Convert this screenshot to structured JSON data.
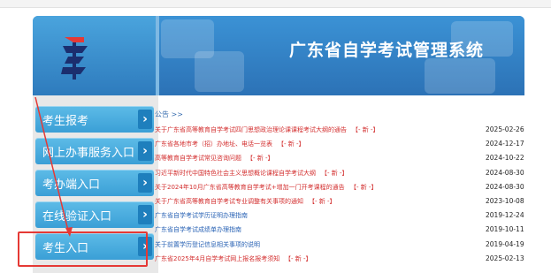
{
  "topbar": {
    "crumbs": ""
  },
  "header": {
    "title": "广东省自学考试管理系统"
  },
  "sidebar": {
    "items": [
      {
        "label": "考生报考"
      },
      {
        "label": "网上办事服务入口"
      },
      {
        "label": "考办端入口"
      },
      {
        "label": "在线验证入口"
      },
      {
        "label": "考生入口"
      }
    ]
  },
  "notices": {
    "heading": "公告 >>",
    "items": [
      {
        "title": "关于广东省高等教育自学考试四门思想政治理论课课程考试大纲的通告",
        "tag": "【- 新 -】",
        "date": "2025-02-26",
        "color": "red"
      },
      {
        "title": "广东省各地市考（招）办地址、电话一览表",
        "tag": "【- 新 -】",
        "date": "2024-12-17",
        "color": "red"
      },
      {
        "title": "高等教育自学考试常见咨询问题",
        "tag": "【- 新 -】",
        "date": "2024-10-22",
        "color": "red"
      },
      {
        "title": "习近平新时代中国特色社会主义思想概论课程自学考试大纲",
        "tag": "【- 新 -】",
        "date": "2024-08-30",
        "color": "red"
      },
      {
        "title": "关于2024年10月广东省高等教育自学考试+增加一门开考课程的通告",
        "tag": "【- 新 -】",
        "date": "2024-08-30",
        "color": "red"
      },
      {
        "title": "关于广东省高等教育自学考试专业调整有关事项的通知",
        "tag": "【- 新 -】",
        "date": "2023-10-08",
        "color": "red"
      },
      {
        "title": "广东省自学考试学历证明办理指南",
        "tag": "",
        "date": "2019-12-24",
        "color": "blue"
      },
      {
        "title": "广东省自学考试成绩单办理指南",
        "tag": "",
        "date": "2019-10-11",
        "color": "blue"
      },
      {
        "title": "关于前置学历登记信息相关事项的说明",
        "tag": "",
        "date": "2019-04-19",
        "color": "blue"
      },
      {
        "title": "广东省2025年4月自学考试网上报名报考须知",
        "tag": "【- 新 -】",
        "date": "2025-02-13",
        "color": "red"
      }
    ]
  },
  "colors": {
    "accent": "#2c72b6",
    "sidebar_button": "#3a9fd6",
    "highlight": "#e53935",
    "notice_red": "#d32f2f",
    "notice_blue": "#2a63b5"
  }
}
